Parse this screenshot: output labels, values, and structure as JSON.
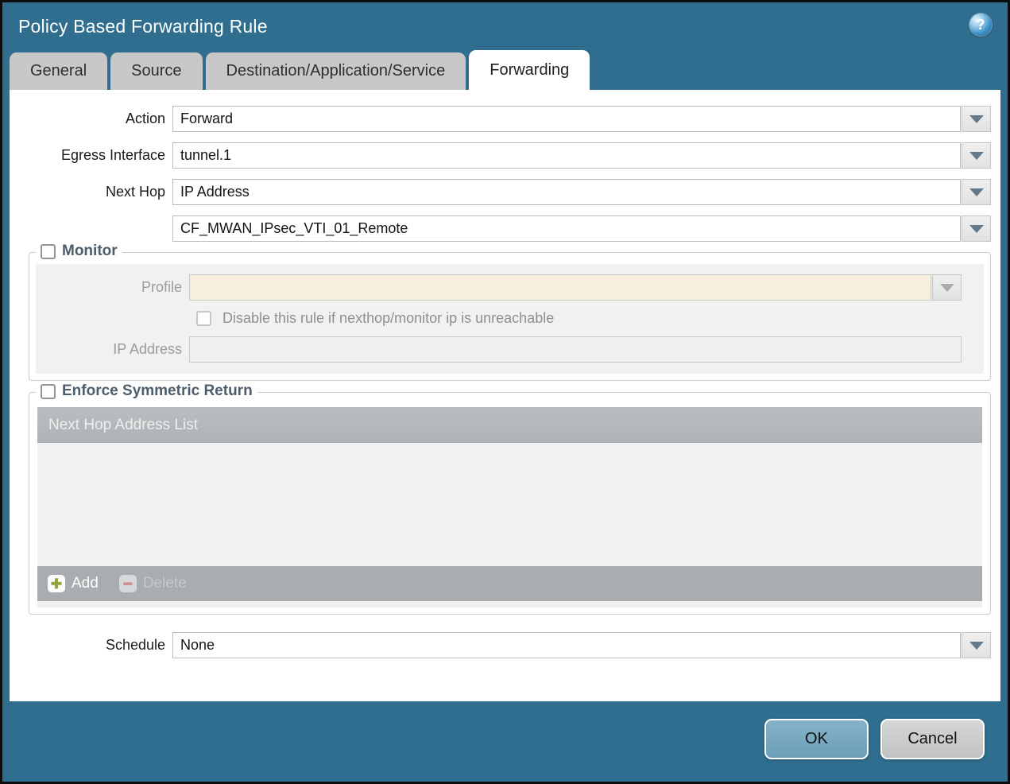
{
  "dialog": {
    "title": "Policy Based Forwarding Rule",
    "help_glyph": "?"
  },
  "tabs": [
    {
      "label": "General",
      "active": false
    },
    {
      "label": "Source",
      "active": false
    },
    {
      "label": "Destination/Application/Service",
      "active": false
    },
    {
      "label": "Forwarding",
      "active": true
    }
  ],
  "form": {
    "action": {
      "label": "Action",
      "value": "Forward"
    },
    "egress_interface": {
      "label": "Egress Interface",
      "value": "tunnel.1"
    },
    "next_hop": {
      "label": "Next Hop",
      "value": "IP Address"
    },
    "next_hop_address": {
      "value": "CF_MWAN_IPsec_VTI_01_Remote"
    },
    "schedule": {
      "label": "Schedule",
      "value": "None"
    }
  },
  "monitor": {
    "label": "Monitor",
    "checked": false,
    "profile": {
      "label": "Profile",
      "value": ""
    },
    "disable_rule": {
      "label": "Disable this rule if nexthop/monitor ip is unreachable",
      "checked": false
    },
    "ip_address": {
      "label": "IP Address",
      "value": ""
    }
  },
  "enforce_symmetric_return": {
    "label": "Enforce Symmetric Return",
    "checked": false,
    "table": {
      "header": "Next Hop Address List",
      "rows": []
    },
    "add_label": "Add",
    "delete_label": "Delete",
    "delete_enabled": false
  },
  "footer": {
    "ok_label": "OK",
    "cancel_label": "Cancel"
  },
  "colors": {
    "titlebar": "#2f6e8e",
    "ok_button": "#74a7bf",
    "profile_field_disabled": "#f6efdf",
    "table_header": "#b3b7b9"
  }
}
